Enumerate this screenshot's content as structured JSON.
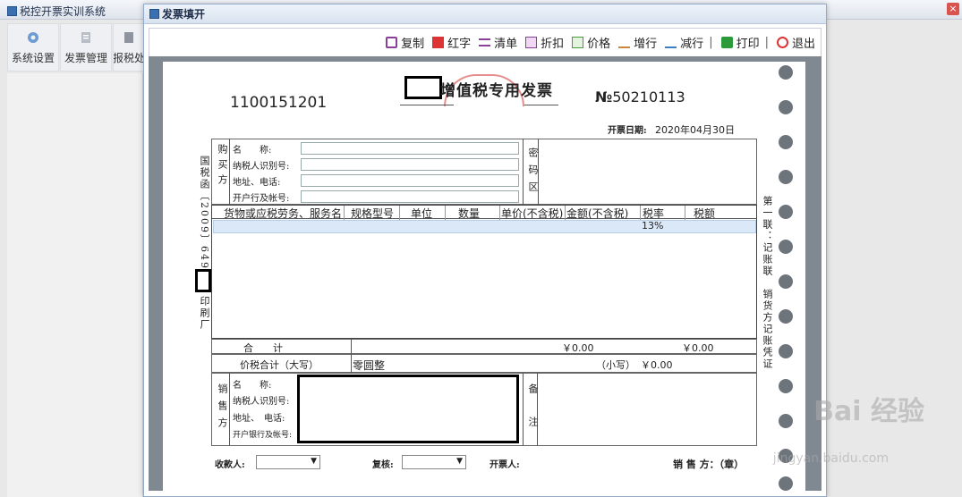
{
  "app": {
    "title": "税控开票实训系统",
    "close": "×",
    "toolbar": [
      {
        "label": "系统设置",
        "icon": "gear-icon"
      },
      {
        "label": "发票管理",
        "icon": "invoice-icon"
      },
      {
        "label": "报税处",
        "icon": "tax-report-icon"
      }
    ]
  },
  "dialog": {
    "title": "发票填开",
    "actions": [
      {
        "label": "复制",
        "icon": "copy-icon",
        "color": "#8a3f9a"
      },
      {
        "label": "红字",
        "icon": "red-invoice-icon",
        "color": "#d33"
      },
      {
        "label": "清单",
        "icon": "list-icon",
        "color": "#8a3f9a"
      },
      {
        "label": "折扣",
        "icon": "discount-icon",
        "color": "#8a3f9a"
      },
      {
        "label": "价格",
        "icon": "price-icon",
        "color": "#4a9a3a"
      },
      {
        "label": "增行",
        "icon": "add-row-icon",
        "color": "#c8873a"
      },
      {
        "label": "减行",
        "icon": "remove-row-icon",
        "color": "#3a7fc8"
      },
      {
        "label": "打印",
        "icon": "print-icon",
        "color": "#2a9a3a"
      },
      {
        "label": "退出",
        "icon": "power-icon",
        "color": "#d33"
      }
    ]
  },
  "invoice": {
    "code": "1100151201",
    "title": "增值税专用发票",
    "number_prefix": "№",
    "number": "50210113",
    "date_label": "开票日期:",
    "date": "2020年04月30日",
    "buyer_label": "购买方",
    "buyer_fields": [
      "名　　称:",
      "纳税人识别号:",
      "地址、电话:",
      "开户行及帐号:"
    ],
    "cipher_label": "密码区",
    "columns": [
      "货物或应税劳务、服务名",
      "规格型号",
      "单位",
      "数量",
      "单价(不含税)",
      "金额(不含税)",
      "税率",
      "税额"
    ],
    "tax_rate": "13%",
    "total_label": "合　　计",
    "total_amount": "￥0.00",
    "total_tax": "￥0.00",
    "grand_label": "价税合计（大写）",
    "grand_words": "零圆整",
    "small_label": "（小写）",
    "small_amount": "￥0.00",
    "seller_label": "销售方",
    "seller_fields": [
      "名　　称:",
      "纳税人识别号:",
      "地址、　电话:",
      "开户银行及帐号:"
    ],
    "remark_label": "备注",
    "payee_label": "收款人:",
    "reviewer_label": "复核:",
    "drawer_label": "开票人:",
    "seller_seal_label": "销 售 方：（章）",
    "left_side_text": "国税函〔2009〕649号",
    "left_side_text2": "印刷厂",
    "right_side_text": "第一联：记账联　销货方记账凭证"
  },
  "watermark": {
    "main": "Bai 经验",
    "sub": "jingyan.baidu.com"
  }
}
